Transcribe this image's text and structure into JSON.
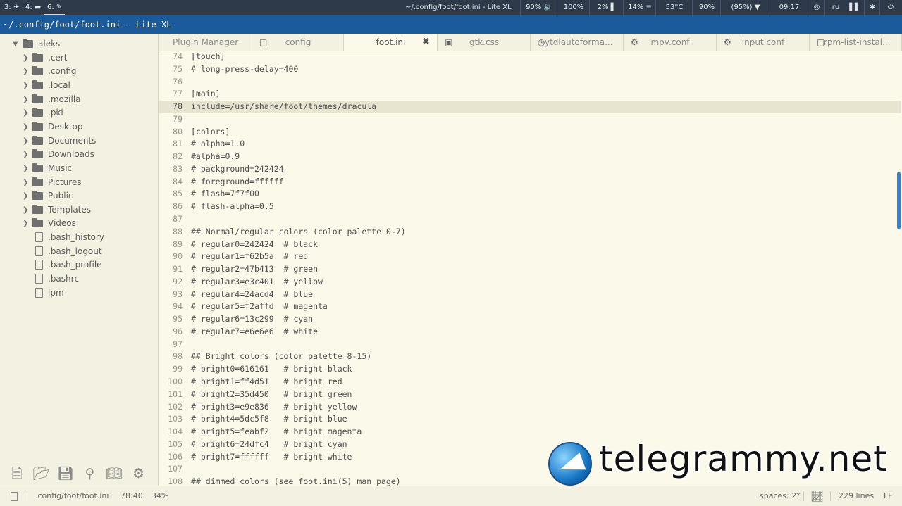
{
  "topbar": {
    "workspaces": [
      {
        "label": "3: ✈",
        "active": false
      },
      {
        "label": "4: ▬",
        "active": false
      },
      {
        "label": "6: ✎",
        "active": true
      }
    ],
    "window_title": "~/.config/foot/foot.ini - Lite XL",
    "stats": [
      "90% 🔉",
      "100%",
      "2% ▌",
      "14% ≡",
      "53°C",
      "90%",
      "(95%) ▼",
      "09:17",
      "◎",
      "ru",
      "▌▌",
      "✱",
      "⏻"
    ]
  },
  "titlebar": {
    "title": "~/.config/foot/foot.ini - Lite XL"
  },
  "sidebar": {
    "items": [
      {
        "label": "aleks",
        "type": "folder",
        "expanded": true
      },
      {
        "label": ".cert",
        "type": "folder"
      },
      {
        "label": ".config",
        "type": "folder"
      },
      {
        "label": ".local",
        "type": "folder"
      },
      {
        "label": ".mozilla",
        "type": "folder"
      },
      {
        "label": ".pki",
        "type": "folder"
      },
      {
        "label": "Desktop",
        "type": "folder"
      },
      {
        "label": "Documents",
        "type": "folder"
      },
      {
        "label": "Downloads",
        "type": "folder"
      },
      {
        "label": "Music",
        "type": "folder"
      },
      {
        "label": "Pictures",
        "type": "folder"
      },
      {
        "label": "Public",
        "type": "folder"
      },
      {
        "label": "Templates",
        "type": "folder"
      },
      {
        "label": "Videos",
        "type": "folder"
      },
      {
        "label": ".bash_history",
        "type": "file"
      },
      {
        "label": ".bash_logout",
        "type": "file"
      },
      {
        "label": ".bash_profile",
        "type": "file"
      },
      {
        "label": ".bashrc",
        "type": "file"
      },
      {
        "label": "lpm",
        "type": "file"
      }
    ],
    "tools": [
      "new-file-icon",
      "open-folder-icon",
      "save-icon",
      "search-icon",
      "book-icon",
      "gear-icon"
    ]
  },
  "tabs": [
    {
      "label": "Plugin Manager",
      "icon": ""
    },
    {
      "label": "config",
      "icon": "□"
    },
    {
      "label": "foot.ini",
      "icon": "",
      "active": true,
      "close": "✖"
    },
    {
      "label": "gtk.css",
      "icon": "▣"
    },
    {
      "label": "ytdlautoforma...",
      "icon": "◷"
    },
    {
      "label": "mpv.conf",
      "icon": "⚙"
    },
    {
      "label": "input.conf",
      "icon": "⚙"
    },
    {
      "label": "rpm-list-instal...",
      "icon": "□"
    }
  ],
  "editor": {
    "current_line": 78,
    "lines": [
      {
        "n": "74",
        "t": "[touch]"
      },
      {
        "n": "75",
        "t": "# long-press-delay=400"
      },
      {
        "n": "76",
        "t": ""
      },
      {
        "n": "77",
        "t": "[main]"
      },
      {
        "n": "78",
        "t": "include=/usr/share/foot/themes/dracula"
      },
      {
        "n": "79",
        "t": ""
      },
      {
        "n": "80",
        "t": "[colors]"
      },
      {
        "n": "81",
        "t": "# alpha=1.0"
      },
      {
        "n": "82",
        "t": "#alpha=0.9"
      },
      {
        "n": "83",
        "t": "# background=242424"
      },
      {
        "n": "84",
        "t": "# foreground=ffffff"
      },
      {
        "n": "85",
        "t": "# flash=7f7f00"
      },
      {
        "n": "86",
        "t": "# flash-alpha=0.5"
      },
      {
        "n": "87",
        "t": ""
      },
      {
        "n": "88",
        "t": "## Normal/regular colors (color palette 0-7)"
      },
      {
        "n": "89",
        "t": "# regular0=242424  # black"
      },
      {
        "n": "90",
        "t": "# regular1=f62b5a  # red"
      },
      {
        "n": "91",
        "t": "# regular2=47b413  # green"
      },
      {
        "n": "92",
        "t": "# regular3=e3c401  # yellow"
      },
      {
        "n": "93",
        "t": "# regular4=24acd4  # blue"
      },
      {
        "n": "94",
        "t": "# regular5=f2affd  # magenta"
      },
      {
        "n": "95",
        "t": "# regular6=13c299  # cyan"
      },
      {
        "n": "96",
        "t": "# regular7=e6e6e6  # white"
      },
      {
        "n": "97",
        "t": ""
      },
      {
        "n": "98",
        "t": "## Bright colors (color palette 8-15)"
      },
      {
        "n": "99",
        "t": "# bright0=616161   # bright black"
      },
      {
        "n": "100",
        "t": "# bright1=ff4d51   # bright red"
      },
      {
        "n": "101",
        "t": "# bright2=35d450   # bright green"
      },
      {
        "n": "102",
        "t": "# bright3=e9e836   # bright yellow"
      },
      {
        "n": "103",
        "t": "# bright4=5dc5f8   # bright blue"
      },
      {
        "n": "104",
        "t": "# bright5=feabf2   # bright magenta"
      },
      {
        "n": "105",
        "t": "# bright6=24dfc4   # bright cyan"
      },
      {
        "n": "106",
        "t": "# bright7=ffffff   # bright white"
      },
      {
        "n": "107",
        "t": ""
      },
      {
        "n": "108",
        "t": "## dimmed colors (see foot.ini(5) man page)"
      }
    ]
  },
  "watermark": {
    "text": "telegrammy.net"
  },
  "statusbar": {
    "path": ".config/foot/foot.ini",
    "position": "78:40",
    "percent": "34%",
    "spaces": "spaces: 2*",
    "lines": "229 lines",
    "eol": "LF"
  },
  "colors": {
    "accent": "#1c5b9b",
    "editor_bg": "#fbf9ea",
    "sidebar_bg": "#f3f1e1",
    "scrollbar": "#2f83d4"
  }
}
